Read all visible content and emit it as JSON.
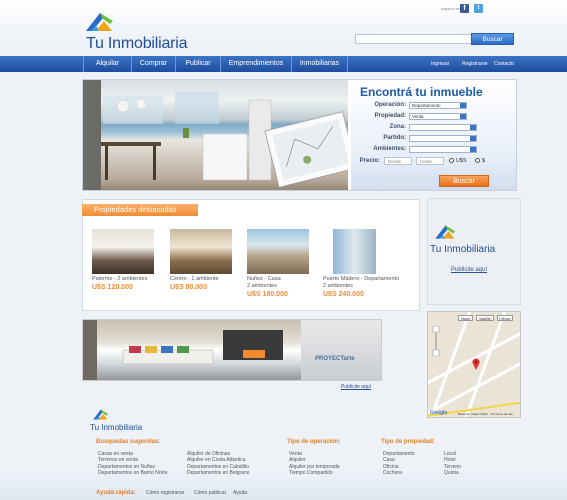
{
  "header": {
    "brand": "Tu Inmobiliaria",
    "social_label": "seguinos en",
    "search": {
      "value": "",
      "button": "Buscar"
    }
  },
  "nav": {
    "items": [
      "Alquilar",
      "Comprar",
      "Publicar",
      "Emprendimientos",
      "Inmobiliarias"
    ],
    "right_links": [
      "Ingresar",
      "Registrarse",
      "Contacto"
    ]
  },
  "search_form": {
    "title": "Encontrá tu inmueble",
    "operacion": {
      "label": "Operación:",
      "value": "Departamento"
    },
    "propiedad": {
      "label": "Propiedad:",
      "value": "Venta"
    },
    "zona": {
      "label": "Zona:",
      "value": ""
    },
    "partido": {
      "label": "Partido:",
      "value": ""
    },
    "ambientes": {
      "label": "Ambientes:",
      "value": ""
    },
    "precio": {
      "label": "Precio:",
      "desde": "Desde",
      "hasta": "Hasta"
    },
    "currency": [
      "U$S",
      "$"
    ],
    "button": "Buscar"
  },
  "featured": {
    "title": "Propiedades destacadas",
    "items": [
      {
        "name": "Palermo - 2 ambientes",
        "name2": "",
        "price": "U$S 120.000"
      },
      {
        "name": "Centro - 1 ambiente",
        "name2": "",
        "price": "U$S 80.000"
      },
      {
        "name": "Nuñez - Casa",
        "name2": "2 ambientes",
        "price": "U$S 180.000"
      },
      {
        "name": "Puerto Madero - Departamento",
        "name2": "2 ambientes",
        "price": "U$S 240.000"
      }
    ]
  },
  "side_ad": {
    "brand": "Tu Inmobiliaria",
    "link": "Publicite aquí"
  },
  "banner": {
    "brand": "PROYECTarte",
    "link": "Publicite aquí"
  },
  "map": {
    "buttons": [
      "Mapa",
      "Satélite",
      "Híbrido"
    ],
    "provider": "Google",
    "copyright": "Datos de mapa ©2011 · Términos de uso"
  },
  "footer": {
    "brand": "Tu Inmobiliaria",
    "busquedas": {
      "title": "Busquedas sugeridas:",
      "col1": [
        "Casas en venta",
        "Terrenos en venta",
        "Departamentos en Nuñez",
        "Departamentos en Barrio Norte"
      ],
      "col2": [
        "Alquiler de Oficinas",
        "Alquiler en Costa Atlántica",
        "Departamentos en Caballito",
        "Departamentos en Belgrano"
      ]
    },
    "operacion": {
      "title": "Tipo de operación:",
      "items": [
        "Venta",
        "Alquiler",
        "Alquiler por temporada",
        "Tiempo Compartido"
      ]
    },
    "propiedad": {
      "title": "Tipo de propiedad:",
      "col1": [
        "Departamento",
        "Casa",
        "Oficina",
        "Cochera"
      ],
      "col2": [
        "Local",
        "Hotel",
        "Terreno",
        "Quinta"
      ]
    },
    "ayuda": {
      "title": "Ayuda rápida:",
      "links": [
        "Cómo registrarse",
        "Cómo publicar",
        "Ayuda"
      ]
    }
  },
  "colors": {
    "brand_blue": "#1f4f9a",
    "nav_blue": "#2a5eb0",
    "accent_orange": "#f08c35"
  }
}
